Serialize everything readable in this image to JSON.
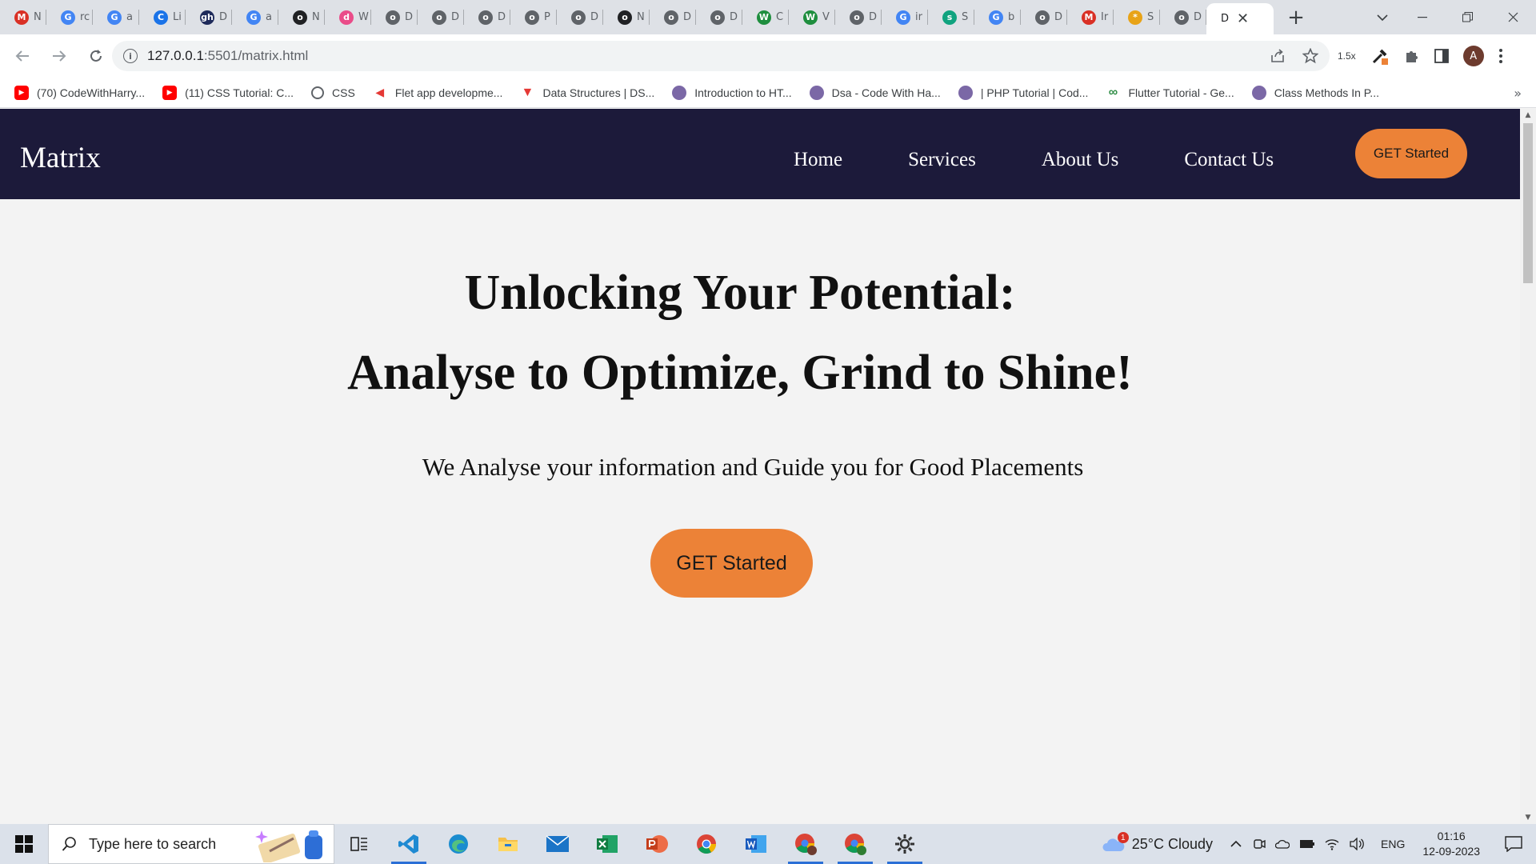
{
  "browser": {
    "tabs": [
      {
        "letter": "N",
        "fav": "M",
        "color": "#d93025"
      },
      {
        "letter": "rc",
        "fav": "G",
        "color": "#4285f4"
      },
      {
        "letter": "a",
        "fav": "G",
        "color": "#4285f4"
      },
      {
        "letter": "Li",
        "fav": "C",
        "color": "#1a73e8"
      },
      {
        "letter": "D",
        "fav": "gh",
        "color": "#1e2a5a"
      },
      {
        "letter": "a",
        "fav": "G",
        "color": "#4285f4"
      },
      {
        "letter": "N",
        "fav": "o",
        "color": "#202124"
      },
      {
        "letter": "W",
        "fav": "d",
        "color": "#ea4c89"
      },
      {
        "letter": "D",
        "fav": "o",
        "color": "#5f6368"
      },
      {
        "letter": "D",
        "fav": "o",
        "color": "#5f6368"
      },
      {
        "letter": "D",
        "fav": "o",
        "color": "#5f6368"
      },
      {
        "letter": "P",
        "fav": "o",
        "color": "#5f6368"
      },
      {
        "letter": "D",
        "fav": "o",
        "color": "#5f6368"
      },
      {
        "letter": "N",
        "fav": "o",
        "color": "#202124"
      },
      {
        "letter": "D",
        "fav": "o",
        "color": "#5f6368"
      },
      {
        "letter": "D",
        "fav": "o",
        "color": "#5f6368"
      },
      {
        "letter": "C",
        "fav": "W",
        "color": "#1e8e3e"
      },
      {
        "letter": "V",
        "fav": "W",
        "color": "#1e8e3e"
      },
      {
        "letter": "D",
        "fav": "o",
        "color": "#5f6368"
      },
      {
        "letter": "ir",
        "fav": "G",
        "color": "#4285f4"
      },
      {
        "letter": "S",
        "fav": "s",
        "color": "#10a37f"
      },
      {
        "letter": "b",
        "fav": "G",
        "color": "#4285f4"
      },
      {
        "letter": "D",
        "fav": "o",
        "color": "#5f6368"
      },
      {
        "letter": "Ir",
        "fav": "M",
        "color": "#d93025"
      },
      {
        "letter": "S",
        "fav": "*",
        "color": "#e8a317"
      },
      {
        "letter": "D",
        "fav": "o",
        "color": "#5f6368"
      }
    ],
    "active_tab": {
      "letter": "D",
      "close": "✕"
    },
    "new_tab": "+",
    "url_host": "127.0.0.1",
    "url_path": ":5501/matrix.html",
    "zoom": "1.5x",
    "avatar_letter": "A",
    "bookmarks": [
      {
        "label": "(70) CodeWithHarry...",
        "icon": "yt",
        "color": "#ff0000"
      },
      {
        "label": "(11) CSS Tutorial: C...",
        "icon": "yt",
        "color": "#ff0000"
      },
      {
        "label": "CSS",
        "icon": "globe",
        "color": "#5f6368"
      },
      {
        "label": "Flet app developme...",
        "icon": "flet",
        "color": "#e53935"
      },
      {
        "label": "Data Structures | DS...",
        "icon": "tri",
        "color": "#e53935"
      },
      {
        "label": "Introduction to HT...",
        "icon": "person",
        "color": "#7b68a6"
      },
      {
        "label": "Dsa - Code With Ha...",
        "icon": "person",
        "color": "#7b68a6"
      },
      {
        "label": "| PHP Tutorial | Cod...",
        "icon": "person",
        "color": "#7b68a6"
      },
      {
        "label": "Flutter Tutorial - Ge...",
        "icon": "gfg",
        "color": "#2f8d46"
      },
      {
        "label": "Class Methods In P...",
        "icon": "person",
        "color": "#7b68a6"
      }
    ],
    "bookmarks_more": "»"
  },
  "site": {
    "brand": "Matrix",
    "nav": [
      "Home",
      "Services",
      "About Us",
      "Contact Us"
    ],
    "nav_cta": "GET Started",
    "hero_line1": "Unlocking Your Potential:",
    "hero_line2": "Analyse to Optimize, Grind to Shine!",
    "hero_sub": "We Analyse your information and Guide you for Good Placements",
    "hero_cta": "GET Started",
    "colors": {
      "nav_bg": "#1c1a3a",
      "accent": "#ec8237",
      "page_bg": "#f3f3f3"
    }
  },
  "taskbar": {
    "search_placeholder": "Type here to search",
    "apps": [
      "task-view",
      "vscode",
      "edge",
      "file-explorer",
      "mail",
      "excel",
      "powerpoint",
      "chrome",
      "word",
      "chrome-profile-a",
      "chrome-profile-b",
      "settings"
    ],
    "weather_badge": "1",
    "weather": "25°C  Cloudy",
    "lang": "ENG",
    "time": "01:16",
    "date": "12-09-2023"
  }
}
